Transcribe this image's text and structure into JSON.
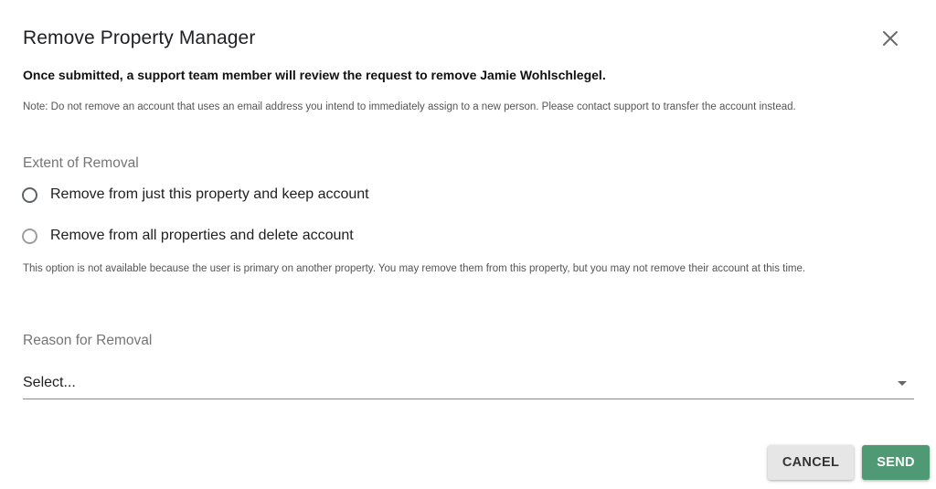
{
  "dialog": {
    "title": "Remove Property Manager",
    "close_icon": "close-icon",
    "subtitle": "Once submitted, a support team member will review the request to remove Jamie Wohlschlegel.",
    "note": "Note: Do not remove an account that uses an email address you intend to immediately assign to a new person. Please contact support to transfer the account instead."
  },
  "extent": {
    "label": "Extent of Removal",
    "options": [
      {
        "label": "Remove from just this property and keep account",
        "selected": false
      },
      {
        "label": "Remove from all properties and delete account",
        "selected": false,
        "disabled": true
      }
    ],
    "help": "This option is not available because the user is primary on another property. You may remove them from this property, but you may not remove their account at this time."
  },
  "reason": {
    "label": "Reason for Removal",
    "select_value": "Select..."
  },
  "actions": {
    "cancel_label": "CANCEL",
    "send_label": "SEND",
    "send_color": "#4f9a74"
  }
}
